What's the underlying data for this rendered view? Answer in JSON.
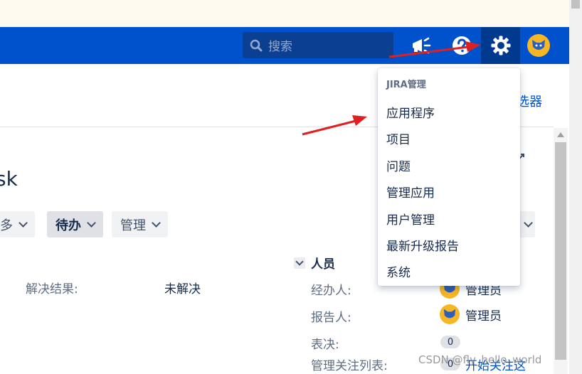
{
  "header": {
    "search_placeholder": "搜索",
    "icons": [
      "search-icon",
      "megaphone-icon",
      "help-icon",
      "gear-icon",
      "avatar"
    ]
  },
  "page": {
    "top_link_partial": "选器",
    "title_partial": "sk",
    "toolbar": {
      "more_partial": "多",
      "todo_label": "待办",
      "admin_label": "管理"
    },
    "fields": {
      "resolution_label": "解决结果:",
      "resolution_value": "未解决"
    },
    "people": {
      "heading": "人员",
      "assignee_label": "经办人:",
      "assignee_value": "管理员",
      "reporter_label": "报告人:",
      "reporter_value": "管理员",
      "votes_label": "表决:",
      "votes_count": "0",
      "watchers_label": "管理关注列表:",
      "watchers_count": "0",
      "watch_link": "开始关注这"
    }
  },
  "dropdown": {
    "heading": "JIRA管理",
    "items": [
      "应用程序",
      "项目",
      "问题",
      "管理应用",
      "用户管理",
      "最新升级报告",
      "系统"
    ]
  },
  "watermark": "CSDN @fly_hello_world",
  "colors": {
    "nav": "#0052cc",
    "banner": "#fffaef",
    "annotation_arrow": "#e02020",
    "avatar": "#f6b726"
  }
}
